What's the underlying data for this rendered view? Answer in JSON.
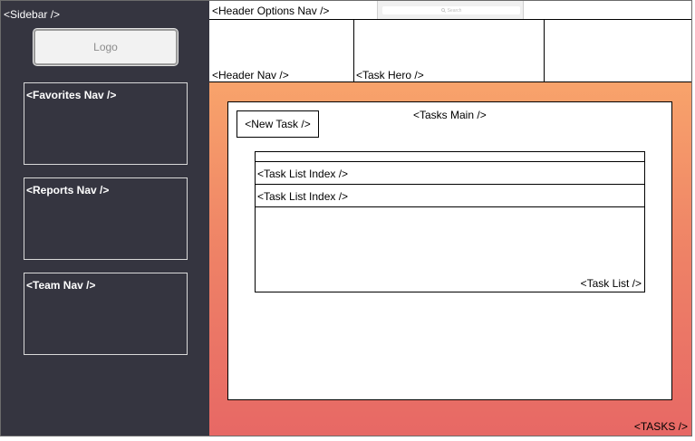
{
  "sidebar": {
    "label": "<Sidebar />",
    "logo": "Logo",
    "navs": [
      {
        "label": "<Favorites Nav />"
      },
      {
        "label": "<Reports Nav />"
      },
      {
        "label": "<Team Nav />"
      }
    ]
  },
  "header": {
    "options_label": "<Header Options Nav />",
    "search_placeholder": "Search",
    "nav_label": "<Header Nav />",
    "hero_label": "<Task Hero />"
  },
  "tasks": {
    "label": "<TASKS />",
    "main_label": "<Tasks Main />",
    "new_task_label": "<New Task />",
    "task_list_label": "<Task List />",
    "task_list_items": [
      {
        "label": "<Task List Index />"
      },
      {
        "label": "<Task List Index />"
      }
    ]
  },
  "colors": {
    "sidebar_bg": "#353540",
    "gradient_top": "#f8a36b",
    "gradient_bottom": "#e76865"
  }
}
